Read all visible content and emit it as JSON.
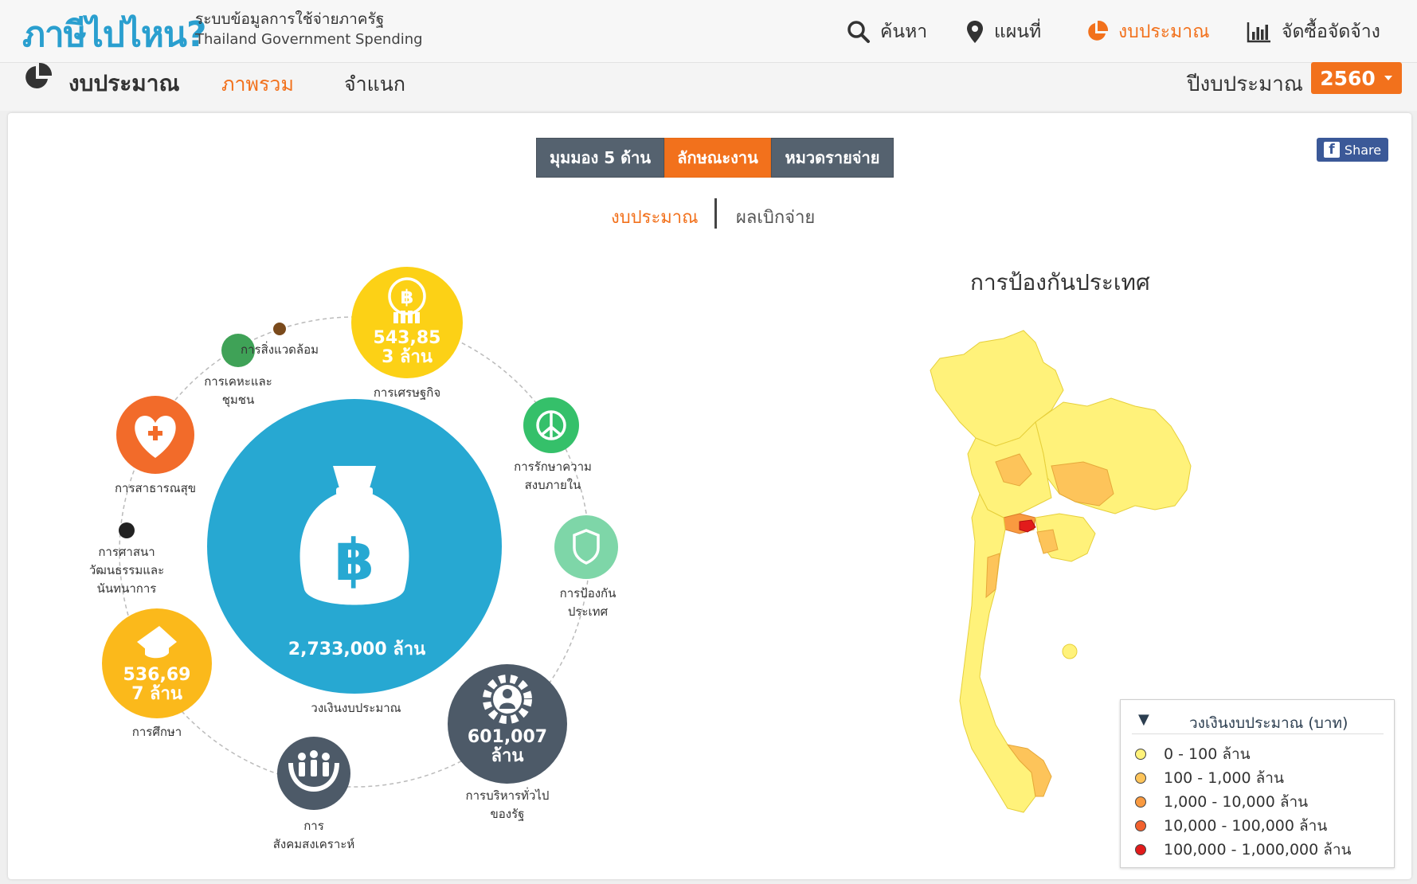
{
  "app": {
    "logo": "ภาษีไปไหน?",
    "tagline_th": "ระบบข้อมูลการใช้จ่ายภาครัฐ",
    "tagline_en": "Thailand Government Spending"
  },
  "nav": {
    "items": [
      {
        "label": "ค้นหา",
        "icon": "search-icon"
      },
      {
        "label": "แผนที่",
        "icon": "map-pin-icon"
      },
      {
        "label": "งบประมาณ",
        "icon": "pie-chart-icon",
        "active": true
      },
      {
        "label": "จัดซื้อจัดจ้าง",
        "icon": "bar-chart-icon"
      }
    ]
  },
  "subnav": {
    "title": "งบประมาณ",
    "tabs": [
      {
        "label": "ภาพรวม",
        "active": true
      },
      {
        "label": "จำแนก"
      }
    ],
    "year_label": "ปีงบประมาณ",
    "year_value": "2560"
  },
  "view_tabs": [
    {
      "label": "มุมมอง 5 ด้าน"
    },
    {
      "label": "ลักษณะงาน",
      "active": true
    },
    {
      "label": "หมวดรายจ่าย"
    }
  ],
  "sub_tabs": [
    {
      "label": "งบประมาณ",
      "active": true
    },
    {
      "label": "ผลเบิกจ่าย"
    }
  ],
  "share_label": "Share",
  "center": {
    "value": "2,733,000 ล้าน",
    "label": "วงเงินงบประมาณ",
    "icon": "money-bag-icon",
    "color": "#27a8d2"
  },
  "categories": {
    "economy": {
      "label": "การเศรษฐกิจ",
      "value_line1": "543,85",
      "value_line2": "3 ล้าน",
      "color": "#fcd116",
      "icon": "baht-coin-icon"
    },
    "environment": {
      "label": "การสิ่งแวดล้อม",
      "color": "#7a4a1c"
    },
    "housing": {
      "label_line1": "การเคหะและ",
      "label_line2": "ชุมชน",
      "color": "#3fa257"
    },
    "health": {
      "label": "การสาธารณสุข",
      "color": "#f26b2a",
      "icon": "heart-plus-icon"
    },
    "religion": {
      "label_line1": "การศาสนา",
      "label_line2": "วัฒนธรรมและ",
      "label_line3": "นันทนาการ",
      "color": "#222222"
    },
    "education": {
      "label": "การศึกษา",
      "value_line1": "536,69",
      "value_line2": "7 ล้าน",
      "color": "#fbb91b",
      "icon": "graduation-cap-icon"
    },
    "social": {
      "label_line1": "การ",
      "label_line2": "สังคมสงเคราะห์",
      "color": "#4d5a68",
      "icon": "family-hands-icon"
    },
    "general": {
      "label_line1": "การบริหารทั่วไป",
      "label_line2": "ของรัฐ",
      "value_line1": "601,007",
      "value_line2": "ล้าน",
      "color": "#4d5a68",
      "icon": "gear-person-icon"
    },
    "defense": {
      "label_line1": "การป้องกัน",
      "label_line2": "ประเทศ",
      "color": "#7ed6a8",
      "icon": "shield-icon"
    },
    "security": {
      "label_line1": "การรักษาความ",
      "label_line2": "สงบภายใน",
      "color": "#35c06a",
      "icon": "peace-icon"
    }
  },
  "map": {
    "title": "การป้องกันประเทศ",
    "legend_title": "วงเงินงบประมาณ (บาท)",
    "legend": [
      {
        "label": "0 - 100 ล้าน",
        "color": "#fff27a"
      },
      {
        "label": "100 - 1,000 ล้าน",
        "color": "#fdc45a"
      },
      {
        "label": "1,000 - 10,000 ล้าน",
        "color": "#f99a40"
      },
      {
        "label": "10,000 - 100,000 ล้าน",
        "color": "#f2612e"
      },
      {
        "label": "100,000 - 1,000,000 ล้าน",
        "color": "#e21b1b"
      }
    ]
  }
}
